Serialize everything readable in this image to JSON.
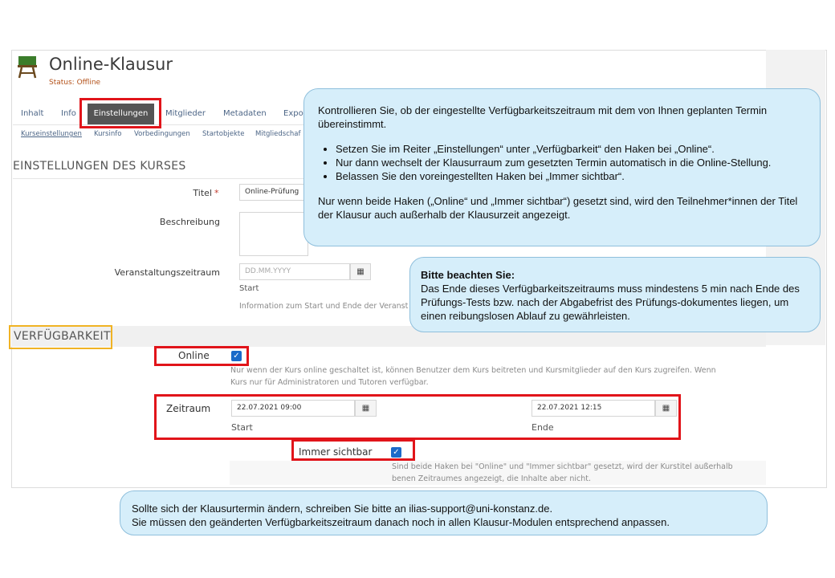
{
  "course": {
    "title": "Online-Klausur",
    "status": "Status: Offline"
  },
  "tabs": [
    "Inhalt",
    "Info",
    "Einstellungen",
    "Mitglieder",
    "Metadaten",
    "Expo"
  ],
  "subtabs": [
    "Kurseinstellungen",
    "Kursinfo",
    "Vorbedingungen",
    "Startobjekte",
    "Mitgliedschaf"
  ],
  "settings": {
    "heading": "EINSTELLUNGEN DES KURSES",
    "title_label": "Titel",
    "required_mark": "*",
    "title_value": "Online-Prüfung",
    "description_label": "Beschreibung",
    "event_period_label": "Veranstaltungszeitraum",
    "date_placeholder": "DD.MM.YYYY",
    "start_label": "Start",
    "event_period_info": "Information zum Start und Ende der Veranst"
  },
  "availability": {
    "heading": "VERFÜGBARKEIT",
    "online_label": "Online",
    "online_help_line1": "Nur wenn der Kurs online geschaltet ist, können Benutzer dem Kurs beitreten und Kursmitglieder auf den Kurs zugreifen. Wenn",
    "online_help_line2": "Kurs nur für Administratoren und Tutoren verfügbar.",
    "period_label": "Zeitraum",
    "start_value": "22.07.2021 09:00",
    "end_value": "22.07.2021 12:15",
    "start_label": "Start",
    "end_label": "Ende",
    "always_visible_label": "Immer sichtbar",
    "always_visible_help_line1": "Sind beide Haken bei \"Online\" und \"Immer sichtbar\" gesetzt, wird der Kurstitel außerhalb",
    "always_visible_help_line2": "benen Zeitraumes angezeigt, die Inhalte aber nicht."
  },
  "callout_main": {
    "intro": "Kontrollieren Sie, ob der eingestellte Verfügbarkeitszeitraum mit dem von Ihnen geplanten Termin übereinstimmt.",
    "bullets": [
      "Setzen Sie im Reiter „Einstellungen“ unter „Verfügbarkeit“ den Haken bei „Online“.",
      "Nur dann wechselt der Klausurraum zum gesetzten Termin automatisch in die Online-Stellung.",
      "Belassen Sie den voreingestellten Haken bei „Immer sichtbar“."
    ],
    "outro": "Nur wenn beide Haken („Online“ und „Immer sichtbar“) gesetzt sind, wird den Teilnehmer*innen der Titel der Klausur auch außerhalb der Klausurzeit angezeigt."
  },
  "callout_note": {
    "title": "Bitte beachten Sie:",
    "body": "Das Ende dieses Verfügbarkeitszeitraums muss mindestens 5 min nach Ende des Prüfungs-Tests bzw. nach der Abgabefrist des Prüfungs-dokumentes liegen, um einen reibungslosen Ablauf zu gewährleisten."
  },
  "callout_bottom": {
    "line1": "Sollte sich der Klausurtermin ändern, schreiben Sie bitte an ilias-support@uni-konstanz.de.",
    "line2": "Sie müssen den geänderten Verfügbarkeitszeitraum danach noch in allen Klausur-Modulen entsprechend anpassen."
  },
  "colors": {
    "highlight_red": "#e1141a",
    "highlight_orange": "#f0b324",
    "callout_bg": "#d6eefa",
    "checkbox": "#1b6ac9",
    "status_offline": "#b4521a"
  }
}
